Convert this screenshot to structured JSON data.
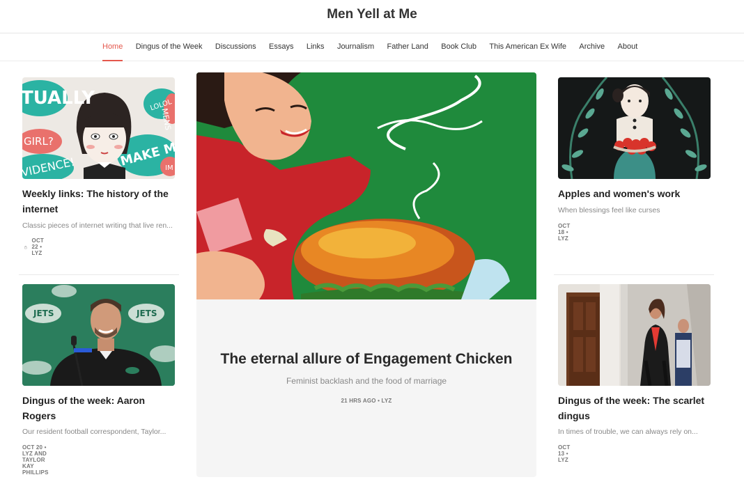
{
  "site": {
    "title": "Men Yell at Me"
  },
  "nav": {
    "items": [
      {
        "label": "Home"
      },
      {
        "label": "Dingus of the Week"
      },
      {
        "label": "Discussions"
      },
      {
        "label": "Essays"
      },
      {
        "label": "Links"
      },
      {
        "label": "Journalism"
      },
      {
        "label": "Father Land"
      },
      {
        "label": "Book Club"
      },
      {
        "label": "This American Ex Wife"
      },
      {
        "label": "Archive"
      },
      {
        "label": "About"
      }
    ]
  },
  "posts": {
    "left_top": {
      "title": "Weekly links: The history of the internet",
      "subtitle": "Classic pieces of internet writing that live ren...",
      "meta": "OCT 22 • LYZ",
      "thumb_words": [
        "TUALLY",
        "LOLOL",
        "MENS",
        "GIRL?",
        "MAKE ME",
        "VIDENCE!",
        "IM"
      ]
    },
    "left_bottom": {
      "title": "Dingus of the week: Aaron Rogers",
      "subtitle": "Our resident football correspondent, Taylor...",
      "meta": "OCT 20 • LYZ AND TAYLOR KAY PHILLIPS"
    },
    "hero": {
      "title": "The eternal allure of Engagement Chicken",
      "subtitle": "Feminist backlash and the food of marriage",
      "meta": "21 HRS AGO • LYZ"
    },
    "right_top": {
      "title": "Apples and women's work",
      "subtitle": "When blessings feel like curses",
      "meta": "OCT 18 • LYZ"
    },
    "right_bottom": {
      "title": "Dingus of the week: The scarlet dingus",
      "subtitle": "In times of trouble, we can always rely on...",
      "meta": "OCT 13 • LYZ"
    }
  },
  "colors": {
    "accent": "#e4574c",
    "hero_green": "#1f8a3c",
    "jets_green": "#125740"
  }
}
